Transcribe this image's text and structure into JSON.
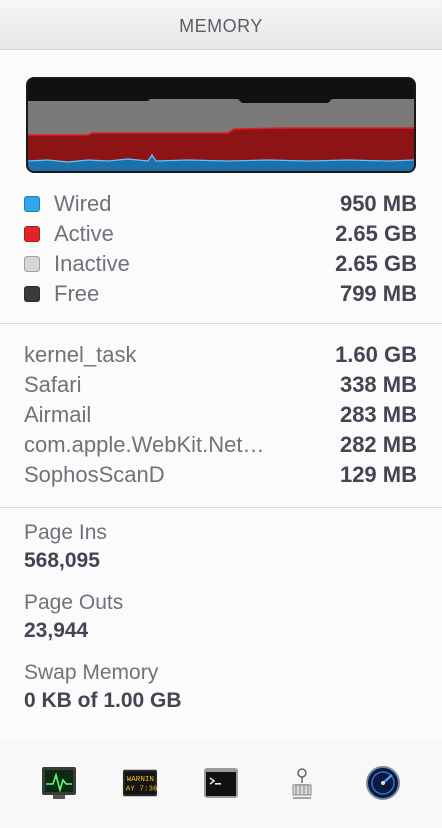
{
  "header": {
    "title": "MEMORY"
  },
  "graph": {
    "colors": {
      "inactive": "#7a7a7a",
      "active": "#8c1414",
      "wired": "#1f6fa8",
      "background": "#111111"
    }
  },
  "legend": [
    {
      "label": "Wired",
      "value": "950 MB",
      "color": "#2ea8ea"
    },
    {
      "label": "Active",
      "value": "2.65 GB",
      "color": "#e0262a"
    },
    {
      "label": "Inactive",
      "value": "2.65 GB",
      "color": "#d6d6d6"
    },
    {
      "label": "Free",
      "value": "799 MB",
      "color": "#3a3a3a"
    }
  ],
  "processes": [
    {
      "name": "kernel_task",
      "value": "1.60 GB"
    },
    {
      "name": "Safari",
      "value": "338 MB"
    },
    {
      "name": "Airmail",
      "value": "283 MB"
    },
    {
      "name": "com.apple.WebKit.Net…",
      "value": "282 MB"
    },
    {
      "name": "SophosScanD",
      "value": "129 MB"
    }
  ],
  "stats": {
    "page_ins_label": "Page Ins",
    "page_ins_value": "568,095",
    "page_outs_label": "Page Outs",
    "page_outs_value": "23,944",
    "swap_label": "Swap Memory",
    "swap_value": "0 KB of 1.00 GB"
  },
  "toolbar": {
    "icons": [
      "activity-monitor-icon",
      "console-icon",
      "terminal-icon",
      "system-information-icon",
      "disk-utility-icon"
    ],
    "console_text_1": "WARNIN",
    "console_text_2": "AY 7:36"
  }
}
